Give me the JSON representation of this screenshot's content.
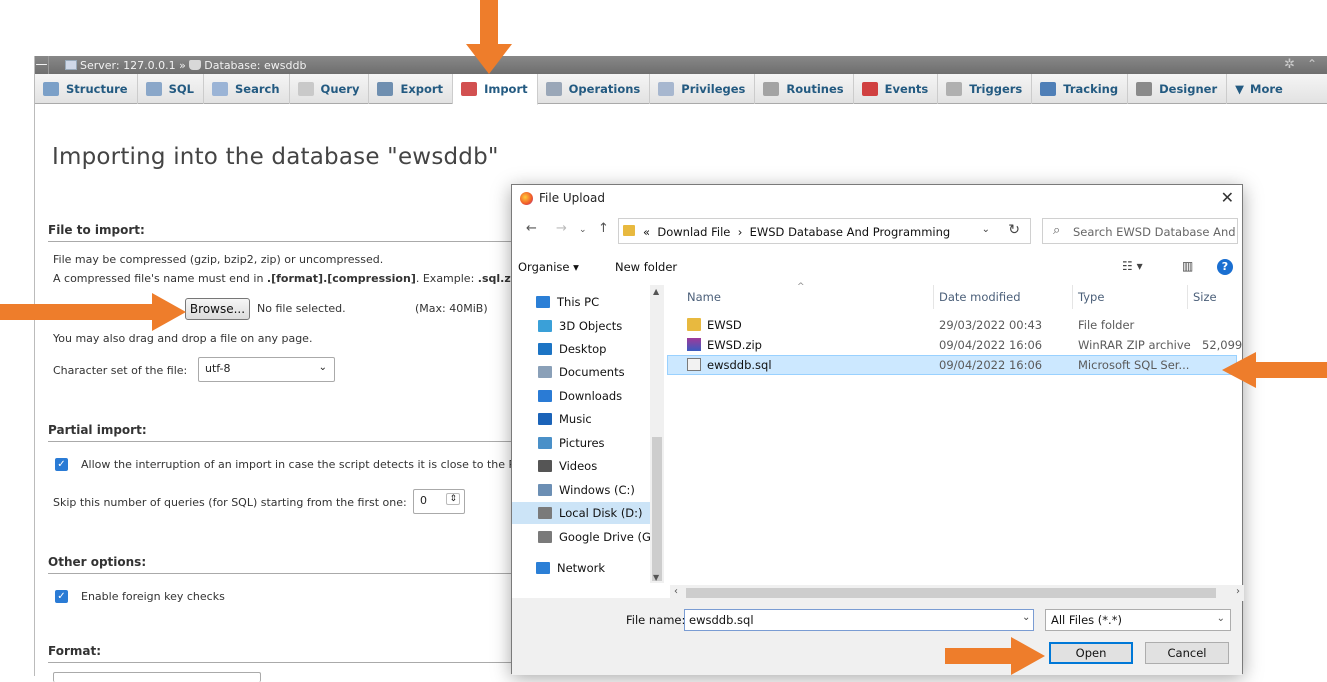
{
  "pma": {
    "breadcrumb": {
      "server": "Server: 127.0.0.1",
      "sep": "»",
      "database": "Database: ewsddb"
    },
    "tabs": [
      {
        "label": "Structure",
        "icon": "structure-icon",
        "color": "#7ba0c8"
      },
      {
        "label": "SQL",
        "icon": "sql-icon",
        "color": "#8aa7c9"
      },
      {
        "label": "Search",
        "icon": "search-icon",
        "color": "#9bb4d6"
      },
      {
        "label": "Query",
        "icon": "query-icon",
        "color": "#c9c9c9"
      },
      {
        "label": "Export",
        "icon": "export-icon",
        "color": "#6f8fb0"
      },
      {
        "label": "Import",
        "icon": "import-icon",
        "color": "#d25050",
        "active": true
      },
      {
        "label": "Operations",
        "icon": "operations-icon",
        "color": "#9aa7b8"
      },
      {
        "label": "Privileges",
        "icon": "privileges-icon",
        "color": "#a7b7cf"
      },
      {
        "label": "Routines",
        "icon": "routines-icon",
        "color": "#a3a3a3"
      },
      {
        "label": "Events",
        "icon": "events-icon",
        "color": "#d04040"
      },
      {
        "label": "Triggers",
        "icon": "triggers-icon",
        "color": "#b0b0b0"
      },
      {
        "label": "Tracking",
        "icon": "tracking-icon",
        "color": "#4f7fb7"
      },
      {
        "label": "Designer",
        "icon": "designer-icon",
        "color": "#8a8a8a"
      },
      {
        "label": "More",
        "icon": "chevron-down-icon",
        "color": "#444444"
      }
    ],
    "page_title": "Importing into the database \"ewsddb\"",
    "file_to_import": {
      "heading": "File to import:",
      "line1": "File may be compressed (gzip, bzip2, zip) or uncompressed.",
      "line2_prefix": "A compressed file's name must end in ",
      "line2_bold": ".[format].[compression]",
      "line2_mid": ". Example: ",
      "line2_example": ".sql.zip",
      "browse_label": "Browse...",
      "no_file": "No file selected.",
      "max_size": "(Max: 40MiB)",
      "drag_drop": "You may also drag and drop a file on any page.",
      "charset_label": "Character set of the file:",
      "charset_value": "utf-8"
    },
    "partial_import": {
      "heading": "Partial import:",
      "allow_interrupt": "Allow the interruption of an import in case the script detects it is close to the PH",
      "skip_label": "Skip this number of queries (for SQL) starting from the first one:",
      "skip_value": "0"
    },
    "other_options": {
      "heading": "Other options:",
      "fk_checks": "Enable foreign key checks"
    },
    "format": {
      "heading": "Format:"
    }
  },
  "dialog": {
    "title": "File Upload",
    "close": "✕",
    "address": {
      "prefix": "«",
      "segments": [
        "Downlad File",
        "›",
        "EWSD Database And Programming"
      ]
    },
    "search_placeholder": "Search EWSD Database And ...",
    "toolbar": {
      "organise": "Organise ▾",
      "new_folder": "New folder"
    },
    "nav_items": [
      {
        "label": "This PC",
        "icon": "pc-icon",
        "color": "#2b7fd6"
      },
      {
        "label": "3D Objects",
        "icon": "3d-objects-icon",
        "color": "#3aa0d8"
      },
      {
        "label": "Desktop",
        "icon": "desktop-icon",
        "color": "#1c74c4"
      },
      {
        "label": "Documents",
        "icon": "documents-icon",
        "color": "#8aa0b8"
      },
      {
        "label": "Downloads",
        "icon": "downloads-icon",
        "color": "#2a7bd5"
      },
      {
        "label": "Music",
        "icon": "music-icon",
        "color": "#1b63b8"
      },
      {
        "label": "Pictures",
        "icon": "pictures-icon",
        "color": "#4a90c8"
      },
      {
        "label": "Videos",
        "icon": "videos-icon",
        "color": "#555555"
      },
      {
        "label": "Windows (C:)",
        "icon": "drive-c-icon",
        "color": "#6c8fb4"
      },
      {
        "label": "Local Disk (D:)",
        "icon": "drive-d-icon",
        "color": "#7a7a7a"
      },
      {
        "label": "Google Drive (G:",
        "icon": "drive-g-icon",
        "color": "#7a7a7a"
      },
      {
        "label": "Network",
        "icon": "network-icon",
        "color": "#2b7fd6"
      }
    ],
    "columns": {
      "name": "Name",
      "date": "Date modified",
      "type": "Type",
      "size": "Size"
    },
    "files": [
      {
        "name": "EWSD",
        "date": "29/03/2022 00:43",
        "type": "File folder",
        "size": "",
        "icon": "folder-icon",
        "color": "#e8b93f"
      },
      {
        "name": "EWSD.zip",
        "date": "09/04/2022 16:06",
        "type": "WinRAR ZIP archive",
        "size": "52,099",
        "icon": "winrar-icon",
        "color": "#8b3a8b"
      },
      {
        "name": "ewsddb.sql",
        "date": "09/04/2022 16:06",
        "type": "Microsoft SQL Ser...",
        "size": "",
        "icon": "sql-file-icon",
        "color": "#7a7a7a",
        "selected": true
      }
    ],
    "file_name_label": "File name:",
    "file_name_value": "ewsddb.sql",
    "file_type": "All Files (*.*)",
    "open_label": "Open",
    "cancel_label": "Cancel"
  },
  "arrow_color": "#ee7d2b"
}
